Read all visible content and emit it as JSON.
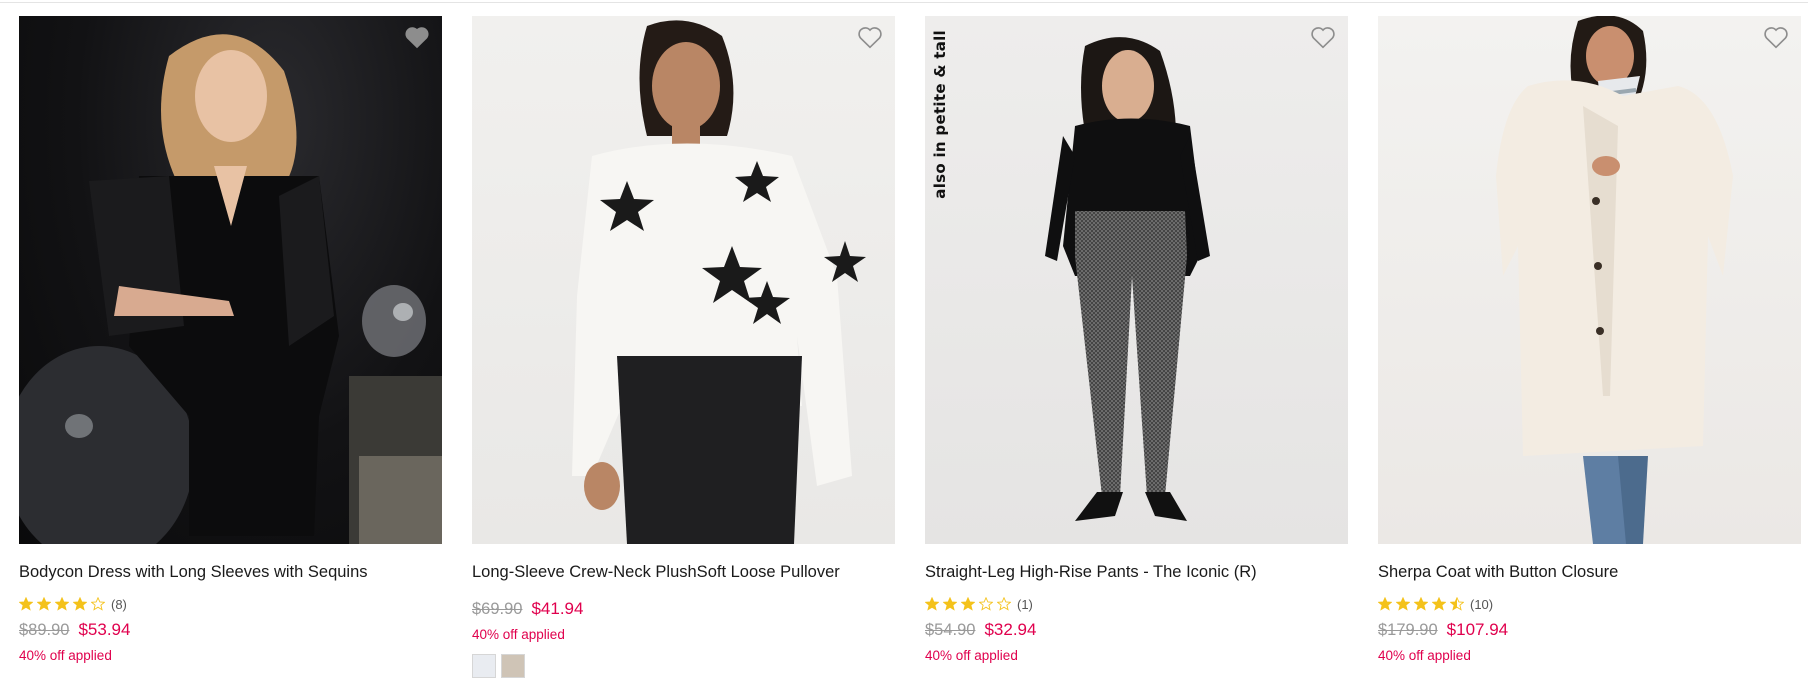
{
  "products": [
    {
      "name": "Bodycon Dress with Long Sleeves with Sequins",
      "rating": 4,
      "rating_max": 5,
      "review_count": "(8)",
      "price_was": "$89.90",
      "price_now": "$53.94",
      "promo": "40% off applied",
      "tag": ""
    },
    {
      "name": "Long-Sleeve Crew-Neck PlushSoft Loose Pullover",
      "price_was": "$69.90",
      "price_now": "$41.94",
      "promo": "40% off applied",
      "swatches": [
        "#e9ecf1",
        "#cfc4b6"
      ],
      "tag": ""
    },
    {
      "name": "Straight-Leg High-Rise Pants - The Iconic (R)",
      "rating": 3,
      "rating_max": 5,
      "review_count": "(1)",
      "price_was": "$54.90",
      "price_now": "$32.94",
      "promo": "40% off applied",
      "tag": "also in petite & tall"
    },
    {
      "name": "Sherpa Coat with Button Closure",
      "rating": 4.5,
      "rating_max": 5,
      "review_count": "(10)",
      "price_was": "$179.90",
      "price_now": "$107.94",
      "promo": "40% off applied",
      "tag": ""
    }
  ],
  "icons": {
    "favorite": "heart-outline-icon",
    "star": "star-icon"
  },
  "colors": {
    "sale_price": "#e0004d",
    "star_fill": "#f4c21b",
    "original_price": "#9a9a9a"
  }
}
